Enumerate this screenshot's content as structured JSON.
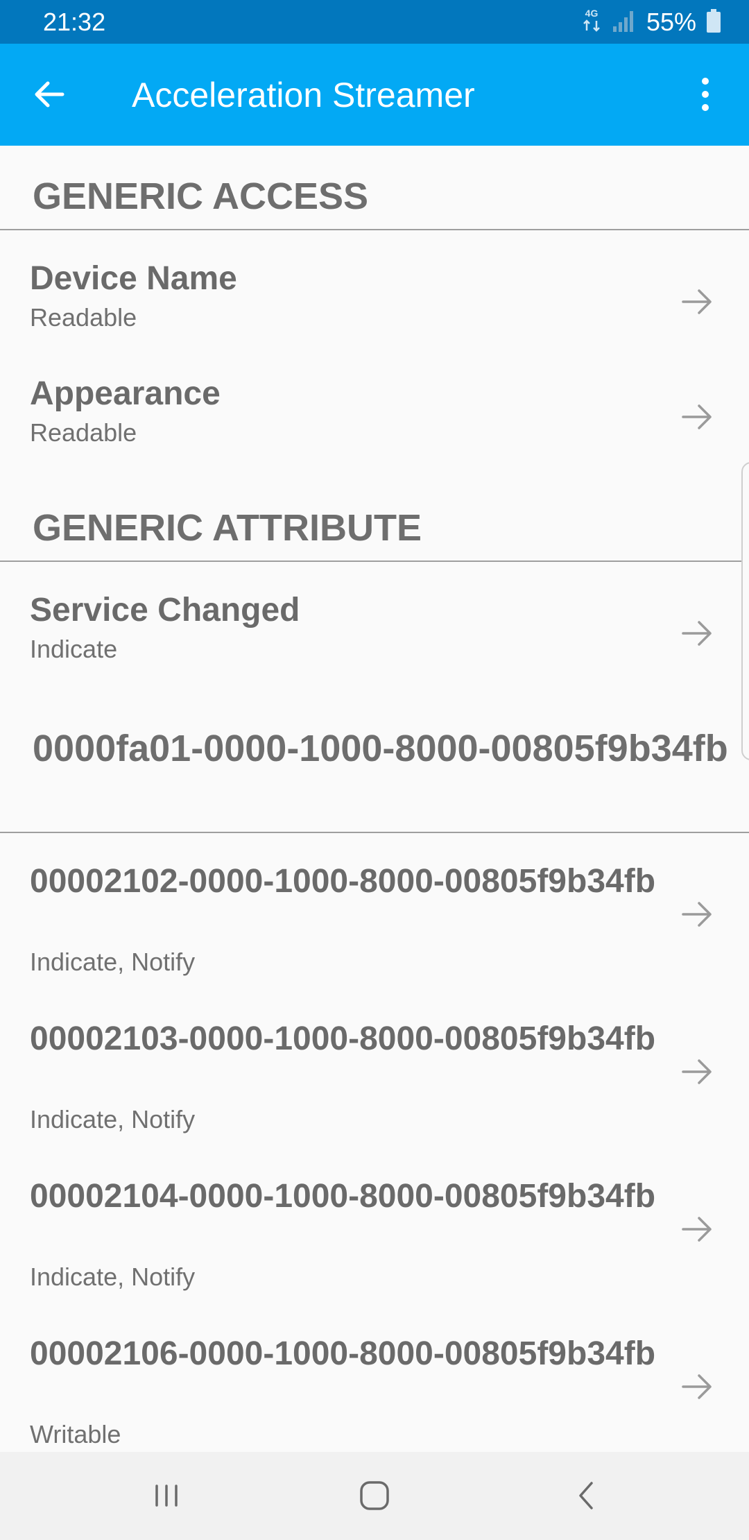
{
  "status_bar": {
    "time": "21:32",
    "network": "4G",
    "battery": "55%"
  },
  "app_bar": {
    "title": "Acceleration Streamer",
    "back_icon": "arrow-left-icon",
    "menu_icon": "more-vert-icon",
    "color": "#03a9f4",
    "status_color": "#0277bd"
  },
  "services": [
    {
      "title": "GENERIC ACCESS",
      "characteristics": [
        {
          "name": "Device Name",
          "properties": "Readable"
        },
        {
          "name": "Appearance",
          "properties": "Readable"
        }
      ]
    },
    {
      "title": "GENERIC ATTRIBUTE",
      "characteristics": [
        {
          "name": "Service Changed",
          "properties": "Indicate"
        }
      ]
    },
    {
      "title": "0000fa01-0000-1000-8000-00805f9b34fb",
      "characteristics": [
        {
          "name": "00002102-0000-1000-8000-00805f9b34fb",
          "properties": "Indicate, Notify"
        },
        {
          "name": "00002103-0000-1000-8000-00805f9b34fb",
          "properties": "Indicate, Notify"
        },
        {
          "name": "00002104-0000-1000-8000-00805f9b34fb",
          "properties": "Indicate, Notify"
        },
        {
          "name": "00002106-0000-1000-8000-00805f9b34fb",
          "properties": "Writable"
        }
      ]
    }
  ],
  "nav_bar": {
    "recents_icon": "recents-icon",
    "home_icon": "home-icon",
    "back_icon": "back-chevron-icon"
  }
}
